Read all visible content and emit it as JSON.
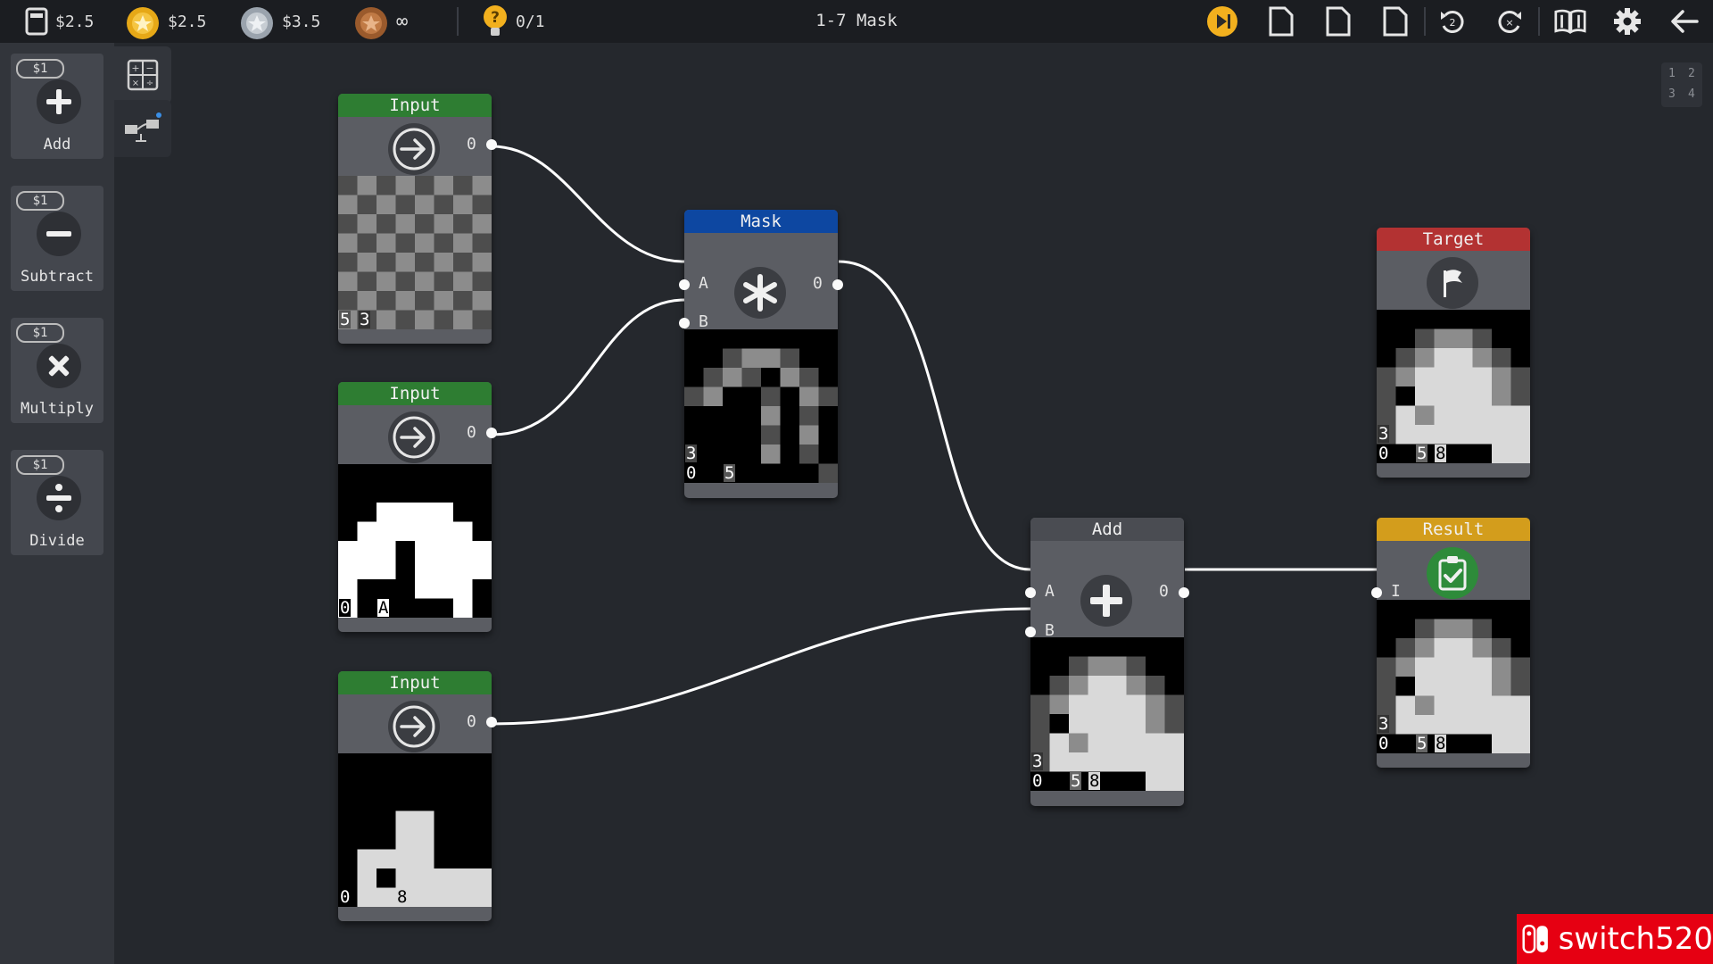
{
  "topbar": {
    "cost_label": "$2.5",
    "gold_label": "$2.5",
    "silver_label": "$3.5",
    "bronze_label": "∞",
    "hint_label": "0/1",
    "level_title": "1-7 Mask",
    "icons": [
      "play-step-icon",
      "document-icon",
      "document-icon",
      "document-icon",
      "undo-icon",
      "redo-icon",
      "library-icon",
      "gear-icon",
      "back-arrow-icon"
    ]
  },
  "sidebar": {
    "operators": [
      {
        "cost": "$1",
        "label": "Add",
        "icon": "plus-icon"
      },
      {
        "cost": "$1",
        "label": "Subtract",
        "icon": "minus-icon"
      },
      {
        "cost": "$1",
        "label": "Multiply",
        "icon": "multiply-icon"
      },
      {
        "cost": "$1",
        "label": "Divide",
        "icon": "divide-icon"
      }
    ]
  },
  "minimap": [
    "1",
    "2",
    "3",
    "4"
  ],
  "nodes": {
    "input1": {
      "title": "Input",
      "port_out": "0",
      "label_a": "5",
      "label_b": "3"
    },
    "input2": {
      "title": "Input",
      "port_out": "0",
      "label_a": "0",
      "label_b": "A"
    },
    "input3": {
      "title": "Input",
      "port_out": "0",
      "label_a": "0",
      "label_b": "8"
    },
    "mask": {
      "title": "Mask",
      "port_a": "A",
      "port_b": "B",
      "port_out": "0",
      "label_a": "3",
      "label_b": "0",
      "label_c": "5"
    },
    "add": {
      "title": "Add",
      "port_a": "A",
      "port_b": "B",
      "port_out": "0",
      "label_a": "3",
      "label_b": "0",
      "label_c": "5",
      "label_d": "8"
    },
    "target": {
      "title": "Target",
      "label_a": "3",
      "label_b": "0",
      "label_c": "5",
      "label_d": "8"
    },
    "result": {
      "title": "Result",
      "port_in": "I",
      "label_a": "3",
      "label_b": "0",
      "label_c": "5",
      "label_d": "8"
    }
  },
  "colors": {
    "input_header": "#2e7d32",
    "mask_header": "#0d47a1",
    "add_header": "#4a4c52",
    "target_header": "#b33232",
    "result_header": "#d39d1c",
    "success": "#2e8b3a"
  },
  "watermark": {
    "text": "switch520"
  }
}
